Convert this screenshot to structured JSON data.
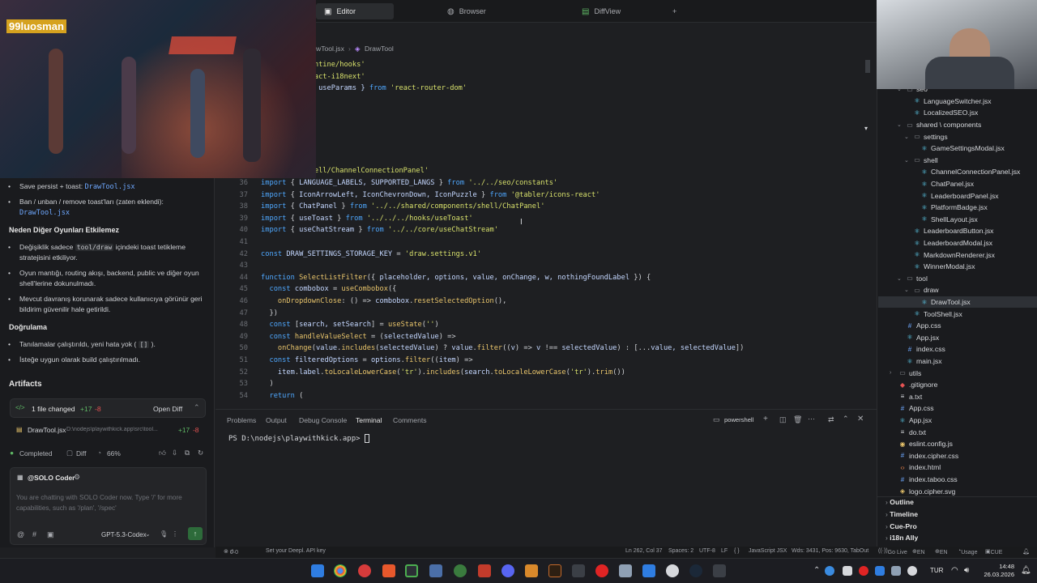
{
  "top_tabs": [
    {
      "label": "Editor",
      "active": true
    },
    {
      "label": "Browser",
      "active": false
    },
    {
      "label": "DiffView",
      "active": false
    }
  ],
  "breadcrumb": {
    "file": "wTool.jsx",
    "symbol": "DrawTool"
  },
  "code_lines": [
    {
      "n": "",
      "parts": [
        [
          "id",
          "isclosure } "
        ],
        [
          "kw",
          "from "
        ],
        [
          "str",
          "'@mantine/hooks'"
        ]
      ]
    },
    {
      "n": "",
      "parts": [
        [
          "id",
          "ranslation } "
        ],
        [
          "kw",
          "from "
        ],
        [
          "str",
          "'react-i18next'"
        ]
      ]
    },
    {
      "n": "",
      "parts": [
        [
          "id",
          "ocation, useNavigate, useParams } "
        ],
        [
          "kw",
          "from "
        ],
        [
          "str",
          "'react-router-dom'"
        ]
      ]
    },
    {
      "n": "",
      "parts": []
    },
    {
      "n": "",
      "parts": [
        [
          "id",
          "ectionPanel,"
        ]
      ]
    },
    {
      "n": "",
      "parts": [
        [
          "id",
          "TFORMS,"
        ]
      ]
    },
    {
      "n": "",
      "parts": [
        [
          "id",
          "lStorageValue,"
        ]
      ]
    },
    {
      "n": "",
      "parts": [
        [
          "id",
          "hannels,"
        ]
      ]
    },
    {
      "n": "",
      "parts": [
        [
          "id",
          "elStorageValue,"
        ]
      ]
    },
    {
      "n": "",
      "parts": [
        [
          "str",
          "/shared/components/shell/ChannelConnectionPanel'"
        ]
      ]
    },
    {
      "n": "36",
      "parts": [
        [
          "kw",
          "import "
        ],
        [
          "pl",
          "{ "
        ],
        [
          "id",
          "LANGUAGE_LABELS, SUPPORTED_LANGS "
        ],
        [
          "pl",
          "} "
        ],
        [
          "kw",
          "from "
        ],
        [
          "str",
          "'../../seo/constants'"
        ]
      ]
    },
    {
      "n": "37",
      "parts": [
        [
          "kw",
          "import "
        ],
        [
          "pl",
          "{ "
        ],
        [
          "id",
          "IconArrowLeft, IconChevronDown, IconPuzzle "
        ],
        [
          "pl",
          "} "
        ],
        [
          "kw",
          "from "
        ],
        [
          "str",
          "'@tabler/icons-react'"
        ]
      ]
    },
    {
      "n": "38",
      "parts": [
        [
          "kw",
          "import "
        ],
        [
          "pl",
          "{ "
        ],
        [
          "id",
          "ChatPanel "
        ],
        [
          "pl",
          "} "
        ],
        [
          "kw",
          "from "
        ],
        [
          "str",
          "'../../shared/components/shell/ChatPanel'"
        ]
      ]
    },
    {
      "n": "39",
      "parts": [
        [
          "kw",
          "import "
        ],
        [
          "pl",
          "{ "
        ],
        [
          "id",
          "useToast "
        ],
        [
          "pl",
          "} "
        ],
        [
          "kw",
          "from "
        ],
        [
          "str",
          "'../../../hooks/useToast'"
        ]
      ]
    },
    {
      "n": "40",
      "parts": [
        [
          "kw",
          "import "
        ],
        [
          "pl",
          "{ "
        ],
        [
          "id",
          "useChatStream "
        ],
        [
          "pl",
          "} "
        ],
        [
          "kw",
          "from "
        ],
        [
          "str",
          "'../../core/useChatStream'"
        ]
      ]
    },
    {
      "n": "41",
      "parts": []
    },
    {
      "n": "42",
      "parts": [
        [
          "kw",
          "const "
        ],
        [
          "id",
          "DRAW_SETTINGS_STORAGE_KEY "
        ],
        [
          "pl",
          "= "
        ],
        [
          "str",
          "'draw.settings.v1'"
        ]
      ]
    },
    {
      "n": "43",
      "parts": []
    },
    {
      "n": "44",
      "parts": [
        [
          "kw",
          "function "
        ],
        [
          "fn",
          "SelectListFilter"
        ],
        [
          "pl",
          "({ "
        ],
        [
          "id",
          "placeholder, options, value, onChange, w, nothingFoundLabel "
        ],
        [
          "pl",
          "}) {"
        ]
      ]
    },
    {
      "n": "45",
      "parts": [
        [
          "pl",
          "  "
        ],
        [
          "kw",
          "const "
        ],
        [
          "id",
          "combobox "
        ],
        [
          "pl",
          "= "
        ],
        [
          "fn",
          "useCombobox"
        ],
        [
          "pl",
          "({"
        ]
      ]
    },
    {
      "n": "46",
      "parts": [
        [
          "pl",
          "    "
        ],
        [
          "fn",
          "onDropdownClose"
        ],
        [
          "pl",
          ": () => "
        ],
        [
          "id",
          "combobox"
        ],
        [
          "pl",
          "."
        ],
        [
          "fn",
          "resetSelectedOption"
        ],
        [
          "pl",
          "(),"
        ]
      ]
    },
    {
      "n": "47",
      "parts": [
        [
          "pl",
          "  })"
        ]
      ]
    },
    {
      "n": "48",
      "parts": [
        [
          "pl",
          "  "
        ],
        [
          "kw",
          "const "
        ],
        [
          "pl",
          "["
        ],
        [
          "id",
          "search, setSearch"
        ],
        [
          "pl",
          "] = "
        ],
        [
          "fn",
          "useState"
        ],
        [
          "pl",
          "("
        ],
        [
          "str",
          "''"
        ],
        [
          "pl",
          ")"
        ]
      ]
    },
    {
      "n": "49",
      "parts": [
        [
          "pl",
          "  "
        ],
        [
          "kw",
          "const "
        ],
        [
          "fn",
          "handleValueSelect "
        ],
        [
          "pl",
          "= ("
        ],
        [
          "id",
          "selectedValue"
        ],
        [
          "pl",
          ") =>"
        ]
      ]
    },
    {
      "n": "50",
      "parts": [
        [
          "pl",
          "    "
        ],
        [
          "fn",
          "onChange"
        ],
        [
          "pl",
          "("
        ],
        [
          "id",
          "value"
        ],
        [
          "pl",
          "."
        ],
        [
          "fn",
          "includes"
        ],
        [
          "pl",
          "("
        ],
        [
          "id",
          "selectedValue"
        ],
        [
          "pl",
          ") ? "
        ],
        [
          "id",
          "value"
        ],
        [
          "pl",
          "."
        ],
        [
          "fn",
          "filter"
        ],
        [
          "pl",
          "(("
        ],
        [
          "id",
          "v"
        ],
        [
          "pl",
          ") => "
        ],
        [
          "id",
          "v "
        ],
        [
          "pl",
          "!== "
        ],
        [
          "id",
          "selectedValue"
        ],
        [
          "pl",
          ") : [..."
        ],
        [
          "id",
          "value, selectedValue"
        ],
        [
          "pl",
          "])"
        ]
      ]
    },
    {
      "n": "51",
      "parts": [
        [
          "pl",
          "  "
        ],
        [
          "kw",
          "const "
        ],
        [
          "id",
          "filteredOptions "
        ],
        [
          "pl",
          "= "
        ],
        [
          "id",
          "options"
        ],
        [
          "pl",
          "."
        ],
        [
          "fn",
          "filter"
        ],
        [
          "pl",
          "(("
        ],
        [
          "id",
          "item"
        ],
        [
          "pl",
          ") =>"
        ]
      ]
    },
    {
      "n": "52",
      "parts": [
        [
          "pl",
          "    "
        ],
        [
          "id",
          "item"
        ],
        [
          "pl",
          "."
        ],
        [
          "id",
          "label"
        ],
        [
          "pl",
          "."
        ],
        [
          "fn",
          "toLocaleLowerCase"
        ],
        [
          "pl",
          "("
        ],
        [
          "str",
          "'tr'"
        ],
        [
          "pl",
          ")."
        ],
        [
          "fn",
          "includes"
        ],
        [
          "pl",
          "("
        ],
        [
          "id",
          "search"
        ],
        [
          "pl",
          "."
        ],
        [
          "fn",
          "toLocaleLowerCase"
        ],
        [
          "pl",
          "("
        ],
        [
          "str",
          "'tr'"
        ],
        [
          "pl",
          ")."
        ],
        [
          "fn",
          "trim"
        ],
        [
          "pl",
          "())"
        ]
      ]
    },
    {
      "n": "53",
      "parts": [
        [
          "pl",
          "  )"
        ]
      ]
    },
    {
      "n": "54",
      "parts": [
        [
          "pl",
          "  "
        ],
        [
          "kw",
          "return "
        ],
        [
          "pl",
          "("
        ]
      ]
    }
  ],
  "left_panel": {
    "bullet1_text": "Save persist + toast: ",
    "bullet1_code": "DrawTool.jsx",
    "bullet2_text": "Ban / unban / remove toast'ları (zaten eklendi):",
    "bullet2_code": "DrawTool.jsx",
    "heading1": "Neden Diğer Oyunları Etkilemez",
    "b3_pre": "Değişiklik sadece ",
    "b3_code": "tool/draw",
    "b3_post": " içindeki toast tetikleme",
    "b3_line2": "stratejisini etkiliyor.",
    "b4_line1": "Oyun mantığı, routing akışı, backend, public ve diğer oyun",
    "b4_line2": "shell'lerine dokunulmadı.",
    "b5_line1": "Mevcut davranış korunarak sadece kullanıcıya görünür geri",
    "b5_line2": "bildirim güvenilir hale getirildi.",
    "heading2": "Doğrulama",
    "b6_pre": "Tanılamalar çalıştırıldı, yeni hata yok ( ",
    "b6_code": "[]",
    "b6_post": " ).",
    "b7": "İsteğe uygun olarak build çalıştırılmadı.",
    "artifacts": "Artifacts",
    "changed_label": "1 file changed",
    "changed_plus": "+17",
    "changed_minus": "-8",
    "open_diff": "Open Diff",
    "file_name": "DrawTool.jsx",
    "file_path": "D:\\nodejs\\playwithkick.app\\src\\tool...",
    "file_plus": "+17",
    "file_minus": "-8",
    "completed": "Completed",
    "diff": "Diff",
    "progress": "66%",
    "agent": "@SOLO Coder",
    "chat_placeholder_1": "You are chatting with SOLO Coder now. Type '/' for more",
    "chat_placeholder_2": "capabilities, such as '/plan', '/spec'",
    "model": "GPT-5.3-Codex"
  },
  "bottom_tabs": [
    {
      "label": "Problems",
      "active": false
    },
    {
      "label": "Output",
      "active": false
    },
    {
      "label": "Debug Console",
      "active": false
    },
    {
      "label": "Terminal",
      "active": true
    },
    {
      "label": "Comments",
      "active": false
    }
  ],
  "terminal": {
    "shell": "powershell",
    "prompt": "PS D:\\nodejs\\playwithkick.app> "
  },
  "explorer": [
    {
      "label": "seo",
      "depth": 2,
      "type": "folder",
      "open": true
    },
    {
      "label": "LanguageSwitcher.jsx",
      "depth": 3,
      "type": "jsx"
    },
    {
      "label": "LocalizedSEO.jsx",
      "depth": 3,
      "type": "jsx"
    },
    {
      "label": "shared \\ components",
      "depth": 2,
      "type": "folder",
      "open": true
    },
    {
      "label": "settings",
      "depth": 3,
      "type": "folder",
      "open": true
    },
    {
      "label": "GameSettingsModal.jsx",
      "depth": 4,
      "type": "jsx"
    },
    {
      "label": "shell",
      "depth": 3,
      "type": "folder",
      "open": true
    },
    {
      "label": "ChannelConnectionPanel.jsx",
      "depth": 4,
      "type": "jsx"
    },
    {
      "label": "ChatPanel.jsx",
      "depth": 4,
      "type": "jsx"
    },
    {
      "label": "LeaderboardPanel.jsx",
      "depth": 4,
      "type": "jsx"
    },
    {
      "label": "PlatformBadge.jsx",
      "depth": 4,
      "type": "jsx"
    },
    {
      "label": "ShellLayout.jsx",
      "depth": 4,
      "type": "jsx"
    },
    {
      "label": "LeaderboardButton.jsx",
      "depth": 3,
      "type": "jsx"
    },
    {
      "label": "LeaderboardModal.jsx",
      "depth": 3,
      "type": "jsx"
    },
    {
      "label": "MarkdownRenderer.jsx",
      "depth": 3,
      "type": "jsx"
    },
    {
      "label": "WinnerModal.jsx",
      "depth": 3,
      "type": "jsx"
    },
    {
      "label": "tool",
      "depth": 2,
      "type": "folder",
      "open": true
    },
    {
      "label": "draw",
      "depth": 3,
      "type": "folder",
      "open": true
    },
    {
      "label": "DrawTool.jsx",
      "depth": 4,
      "type": "jsx",
      "selected": true
    },
    {
      "label": "ToolShell.jsx",
      "depth": 3,
      "type": "jsx"
    },
    {
      "label": "App.css",
      "depth": 2,
      "type": "css"
    },
    {
      "label": "App.jsx",
      "depth": 2,
      "type": "jsx"
    },
    {
      "label": "index.css",
      "depth": 2,
      "type": "css"
    },
    {
      "label": "main.jsx",
      "depth": 2,
      "type": "jsx"
    },
    {
      "label": "utils",
      "depth": 1,
      "type": "folder",
      "open": false
    },
    {
      "label": ".gitignore",
      "depth": 1,
      "type": "git"
    },
    {
      "label": "a.txt",
      "depth": 1,
      "type": "txt"
    },
    {
      "label": "App.css",
      "depth": 1,
      "type": "css"
    },
    {
      "label": "App.jsx",
      "depth": 1,
      "type": "jsx"
    },
    {
      "label": "do.txt",
      "depth": 1,
      "type": "txt"
    },
    {
      "label": "eslint.config.js",
      "depth": 1,
      "type": "js"
    },
    {
      "label": "index.cipher.css",
      "depth": 1,
      "type": "css"
    },
    {
      "label": "index.html",
      "depth": 1,
      "type": "html"
    },
    {
      "label": "index.taboo.css",
      "depth": 1,
      "type": "css"
    },
    {
      "label": "logo.cipher.svg",
      "depth": 1,
      "type": "svg"
    }
  ],
  "sections": [
    "Outline",
    "Timeline",
    "Cue-Pro",
    "i18n Ally"
  ],
  "status": {
    "left1": "0",
    "left2": "0",
    "deepl": "Set your Deepl. API key",
    "pos": "Ln 262, Col 37",
    "spaces": "Spaces: 2",
    "enc": "UTF-8",
    "eol": "LF",
    "braces": "{ }",
    "lang": "JavaScript JSX",
    "stats": "Wds: 3431, Pos: 9630, TabOut",
    "golive": "Go Live",
    "en1": "EN",
    "en2": "EN",
    "usage": "Usage",
    "cue": "CUE"
  },
  "overlay": {
    "streamer": "99luosman"
  },
  "taskbar": {
    "lang": "TUR",
    "time": "14:48",
    "date": "26.03.2026"
  },
  "colors": {
    "accent": "#3574f0",
    "green": "#5fb865",
    "red": "#e55353"
  }
}
